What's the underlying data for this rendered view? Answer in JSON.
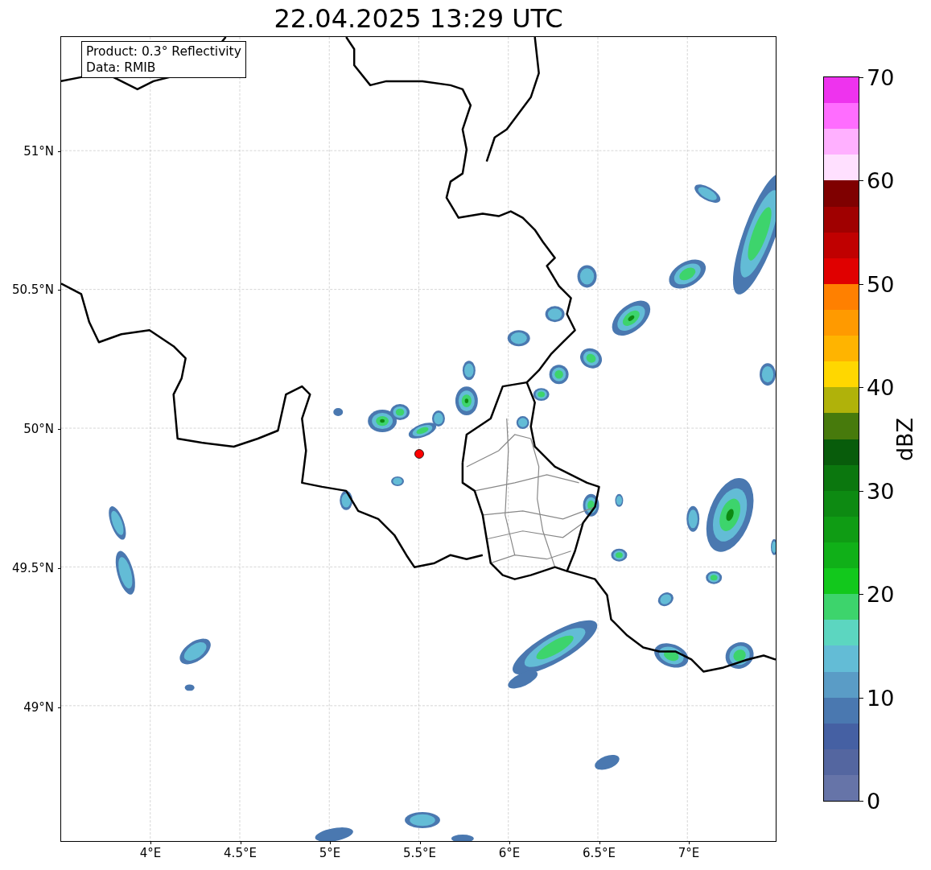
{
  "title": "22.04.2025 13:29 UTC",
  "info_box": {
    "lines": [
      "Product: 0.3° Reflectivity",
      "Data: RMIB"
    ]
  },
  "map": {
    "lat_ticks": [
      "51°N",
      "50.5°N",
      "50°N",
      "49.5°N",
      "49°N"
    ],
    "lon_ticks": [
      "4°E",
      "4.5°E",
      "5°E",
      "5.5°E",
      "6°E",
      "6.5°E",
      "7°E"
    ]
  },
  "colorbar": {
    "label": "dBZ",
    "ticks": [
      "70",
      "60",
      "50",
      "40",
      "30",
      "20",
      "10",
      "0"
    ],
    "bins": [
      {
        "color": "#ee33ee"
      },
      {
        "color": "#ff6dff"
      },
      {
        "color": "#ffb0ff"
      },
      {
        "color": "#ffe0ff"
      },
      {
        "color": "#7f0000"
      },
      {
        "color": "#a00000"
      },
      {
        "color": "#c00000"
      },
      {
        "color": "#e00000"
      },
      {
        "color": "#ff8000"
      },
      {
        "color": "#ff9a00"
      },
      {
        "color": "#ffb400"
      },
      {
        "color": "#ffd700"
      },
      {
        "color": "#b0b20a"
      },
      {
        "color": "#477a0c"
      },
      {
        "color": "#085c0b"
      },
      {
        "color": "#0b770e"
      },
      {
        "color": "#0d8a12"
      },
      {
        "color": "#0f9c14"
      },
      {
        "color": "#10b018"
      },
      {
        "color": "#12c81c"
      },
      {
        "color": "#3dd46c"
      },
      {
        "color": "#5cd6c0"
      },
      {
        "color": "#63bcd6"
      },
      {
        "color": "#5a9cc6"
      },
      {
        "color": "#4a78b0"
      },
      {
        "color": "#4560a3"
      },
      {
        "color": "#5466a0"
      },
      {
        "color": "#6674a8"
      }
    ]
  }
}
